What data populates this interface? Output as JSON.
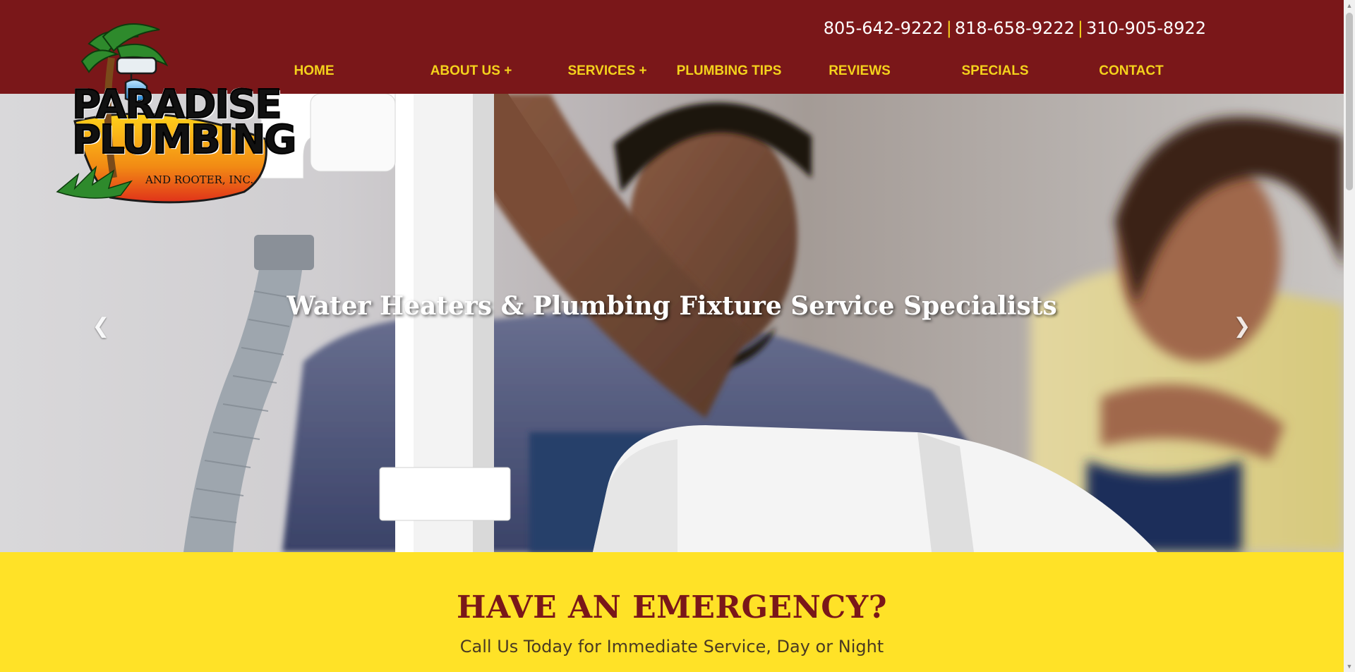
{
  "header": {
    "phones": [
      "805-642-9222",
      "818-658-9222",
      "310-905-8922"
    ],
    "separator": "|"
  },
  "nav": {
    "items": [
      "HOME",
      "ABOUT US +",
      "SERVICES +",
      "PLUMBING TIPS",
      "REVIEWS",
      "SPECIALS",
      "CONTACT"
    ]
  },
  "logo": {
    "line1": "PARADISE",
    "line2": "PLUMBING",
    "line3": "AND ROOTER, INC."
  },
  "hero": {
    "caption": "Water Heaters & Plumbing Fixture Service Specialists",
    "prev_icon": "chevron-left-icon",
    "next_icon": "chevron-right-icon"
  },
  "emergency": {
    "title": "HAVE AN EMERGENCY?",
    "subtitle": "Call Us Today for Immediate Service, Day or Night"
  },
  "colors": {
    "header_bg": "#7a1719",
    "accent_yellow": "#f4d21c",
    "emergency_bg": "#ffe227",
    "title_red": "#7a1719"
  }
}
